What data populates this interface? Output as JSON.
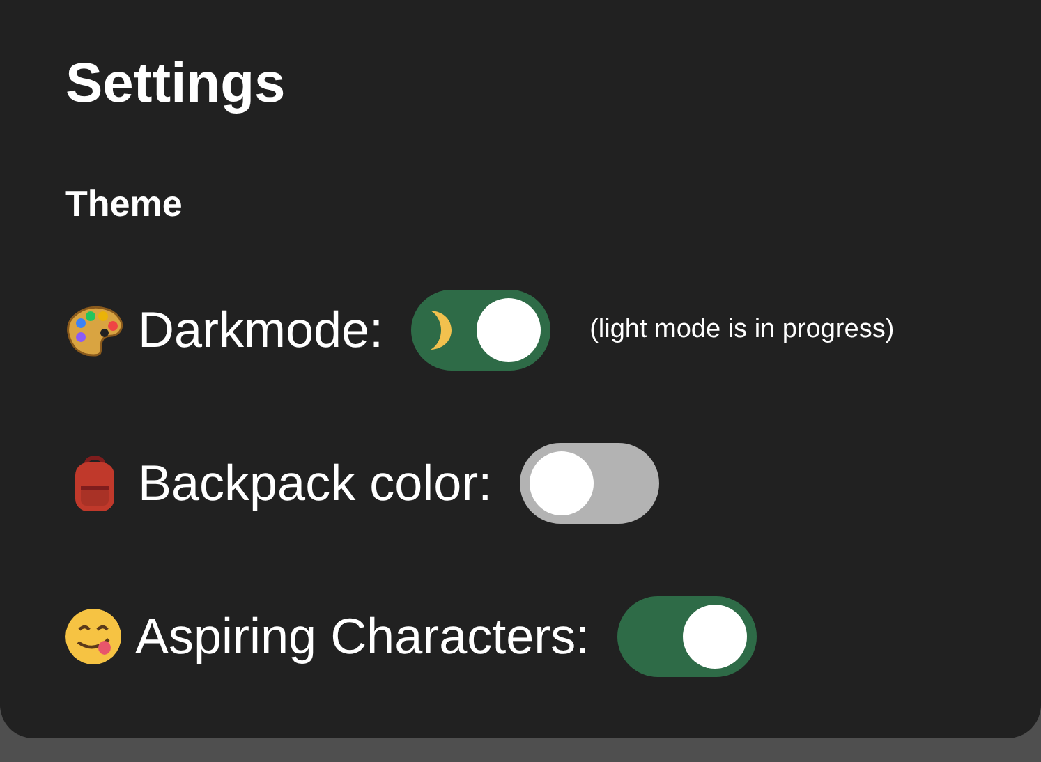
{
  "title": "Settings",
  "section": "Theme",
  "settings": [
    {
      "label": "Darkmode:",
      "on": true,
      "note": "(light mode is in progress)"
    },
    {
      "label": "Backpack color:",
      "on": false
    },
    {
      "label": "Aspiring Characters:",
      "on": true
    }
  ]
}
